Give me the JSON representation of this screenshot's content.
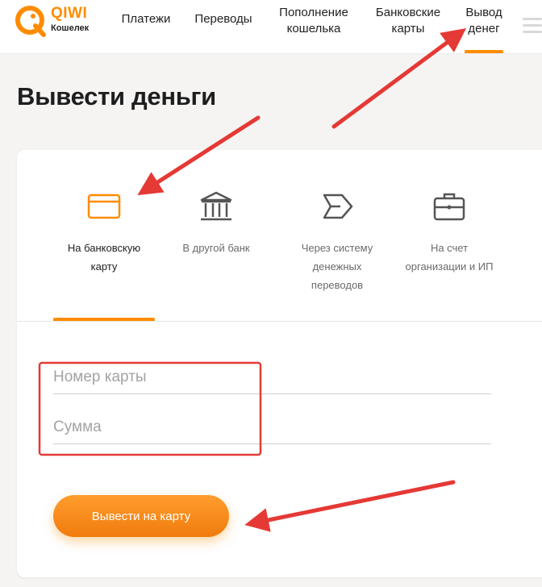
{
  "header": {
    "logo_brand": "QIWI",
    "logo_sub": "Кошелек",
    "nav": [
      {
        "line1": "Платежи",
        "line2": ""
      },
      {
        "line1": "Переводы",
        "line2": ""
      },
      {
        "line1": "Пополнение",
        "line2": "кошелька"
      },
      {
        "line1": "Банковские",
        "line2": "карты"
      },
      {
        "line1": "Вывод",
        "line2": "денег"
      }
    ],
    "active_nav": "Вывод денег"
  },
  "page": {
    "title": "Вывести деньги"
  },
  "methods": [
    {
      "icon": "card-icon",
      "lines": [
        "На банковскую",
        "карту"
      ],
      "active": true
    },
    {
      "icon": "bank-icon",
      "lines": [
        "В другой банк"
      ],
      "active": false
    },
    {
      "icon": "transfer-system-icon",
      "lines": [
        "Через систему",
        "денежных",
        "переводов"
      ],
      "active": false
    },
    {
      "icon": "briefcase-icon",
      "lines": [
        "На счет",
        "организации и ИП"
      ],
      "active": false
    }
  ],
  "form": {
    "card_number_placeholder": "Номер карты",
    "amount_placeholder": "Сумма",
    "submit_label": "Вывести на карту"
  },
  "colors": {
    "accent": "#ff8c00",
    "annotation": "#e53935"
  }
}
